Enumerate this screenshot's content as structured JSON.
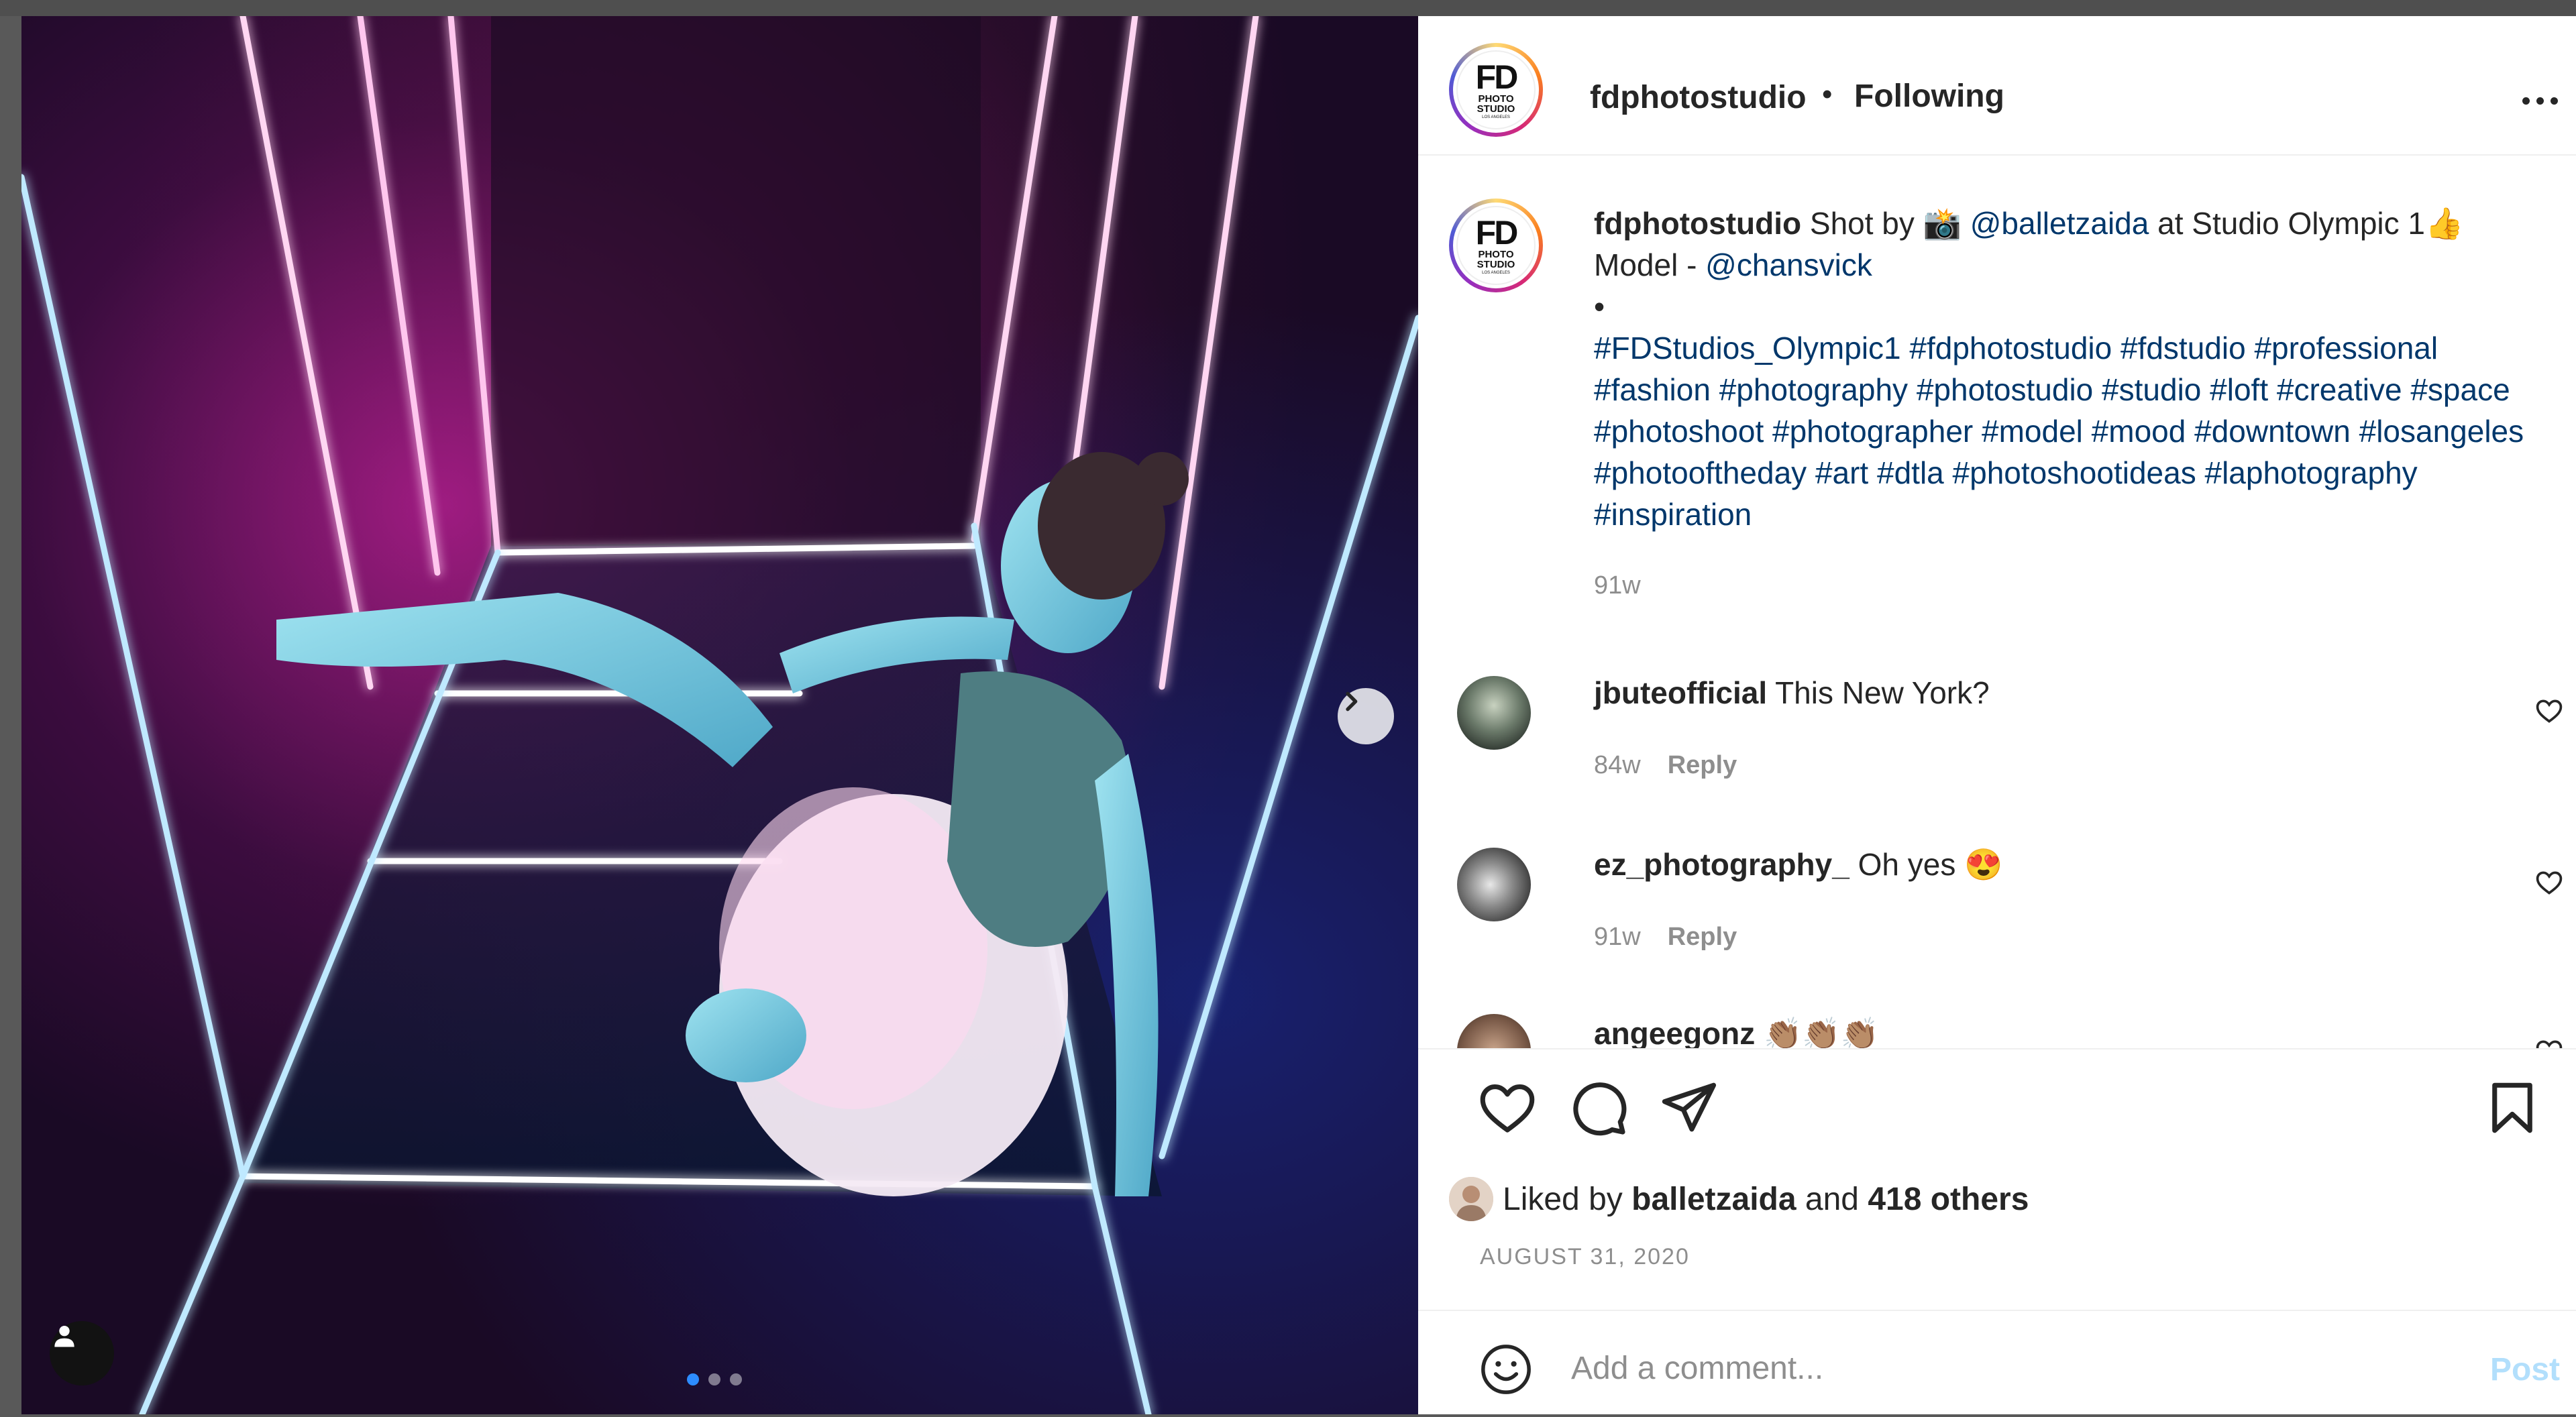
{
  "post": {
    "username": "fdphotostudio",
    "separator": "•",
    "follow_status": "Following",
    "avatar_logo": {
      "main": "FD",
      "line1": "PHOTO",
      "line2": "STUDIO",
      "line3": "LOS ANGELES"
    }
  },
  "caption": {
    "username": "fdphotostudio",
    "text_1": " Shot by 📸 ",
    "mention_1": "@balletzaida",
    "text_2": " at Studio Olympic 1👍",
    "text_3": "Model - ",
    "mention_2": "@chansvick",
    "bullet": "•",
    "hashtags": "#FDStudios_Olympic1 #fdphotostudio #fdstudio #professional #fashion #photography #photostudio #studio #loft #creative #space #photoshoot #photographer #model #mood #downtown #losangeles #photooftheday #art #dtla #photoshootideas #laphotography #inspiration",
    "time": "91w"
  },
  "comments": [
    {
      "username": "jbuteofficial",
      "text": "This New York?",
      "time": "84w",
      "reply": "Reply"
    },
    {
      "username": "ez_photography_",
      "text": "Oh yes 😍",
      "time": "91w",
      "reply": "Reply"
    },
    {
      "username": "angeegonz",
      "text": "👏🏽👏🏽👏🏽"
    }
  ],
  "likes": {
    "prefix": "Liked by ",
    "user": "balletzaida",
    "middle": " and ",
    "others": "418 others"
  },
  "date": "AUGUST 31, 2020",
  "add_comment": {
    "placeholder": "Add a comment...",
    "post_label": "Post"
  },
  "carousel": {
    "count": 3,
    "active_index": 0
  },
  "colors": {
    "link": "#00376b",
    "meta": "#8e8e8e",
    "post_disabled": "#b2dffc",
    "carousel_active": "#2d8cff"
  },
  "icons": [
    "chevron-right-icon",
    "user-tag-icon",
    "more-icon",
    "heart-icon",
    "comment-icon",
    "share-icon",
    "bookmark-icon",
    "emoji-icon"
  ]
}
